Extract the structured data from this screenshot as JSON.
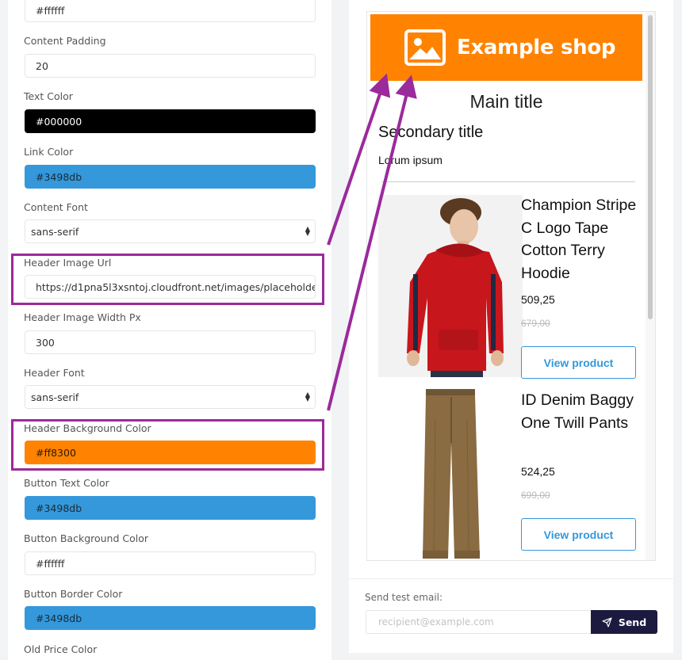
{
  "settings": {
    "top_field_value": "#ffffff",
    "content_padding": {
      "label": "Content Padding",
      "value": "20"
    },
    "text_color": {
      "label": "Text Color",
      "value": "#000000"
    },
    "link_color": {
      "label": "Link Color",
      "value": "#3498db"
    },
    "content_font": {
      "label": "Content Font",
      "value": "sans-serif"
    },
    "header_image_url": {
      "label": "Header Image Url",
      "value": "https://d1pna5l3xsntoj.cloudfront.net/images/placeholde"
    },
    "header_image_width": {
      "label": "Header Image Width Px",
      "value": "300"
    },
    "header_font": {
      "label": "Header Font",
      "value": "sans-serif"
    },
    "header_bg_color": {
      "label": "Header Background Color",
      "value": "#ff8300"
    },
    "button_text_color": {
      "label": "Button Text Color",
      "value": "#3498db"
    },
    "button_bg_color": {
      "label": "Button Background Color",
      "value": "#ffffff"
    },
    "button_border_color": {
      "label": "Button Border Color",
      "value": "#3498db"
    },
    "old_price_color": {
      "label": "Old Price Color"
    }
  },
  "preview": {
    "shop_name": "Example shop",
    "main_title": "Main title",
    "secondary_title": "Secondary title",
    "body_text": "Lorum ipsum",
    "products": [
      {
        "name": "Champion Stripe C Logo Tape Cotton Terry Hoodie",
        "price": "509,25",
        "old_price": "679,00",
        "button": "View product"
      },
      {
        "name": "ID Denim Baggy One Twill Pants",
        "price": "524,25",
        "old_price": "699,00",
        "button": "View product"
      }
    ]
  },
  "send_test": {
    "label": "Send test email:",
    "placeholder": "recipient@example.com",
    "button": "Send"
  },
  "colors": {
    "accent_orange": "#ff8300",
    "link_blue": "#3498db",
    "highlight_purple": "#9b2a9b",
    "send_button": "#1d1a40"
  }
}
